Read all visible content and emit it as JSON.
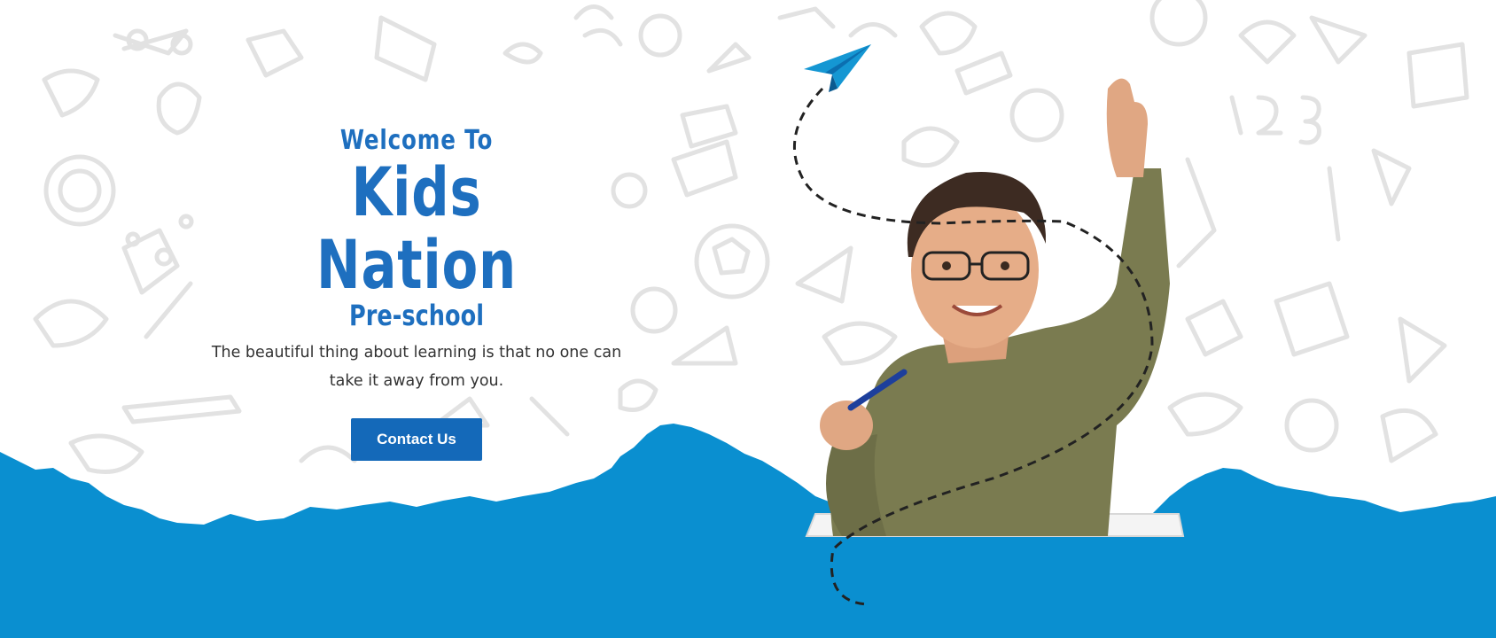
{
  "hero": {
    "welcome": "Welcome To",
    "brand": "Kids Nation",
    "subtitle": "Pre-school",
    "tagline": "The beautiful thing about learning is that no one can take it away from you.",
    "cta_label": "Contact Us"
  },
  "colors": {
    "brand_blue": "#1e6fbf",
    "button_blue": "#1469b9",
    "wave_blue": "#0a8fd0",
    "doodle_gray": "#e4e4e4"
  },
  "icons": [
    "paper-plane-icon",
    "child-photo",
    "doodle-pattern",
    "torn-paper-wave"
  ]
}
